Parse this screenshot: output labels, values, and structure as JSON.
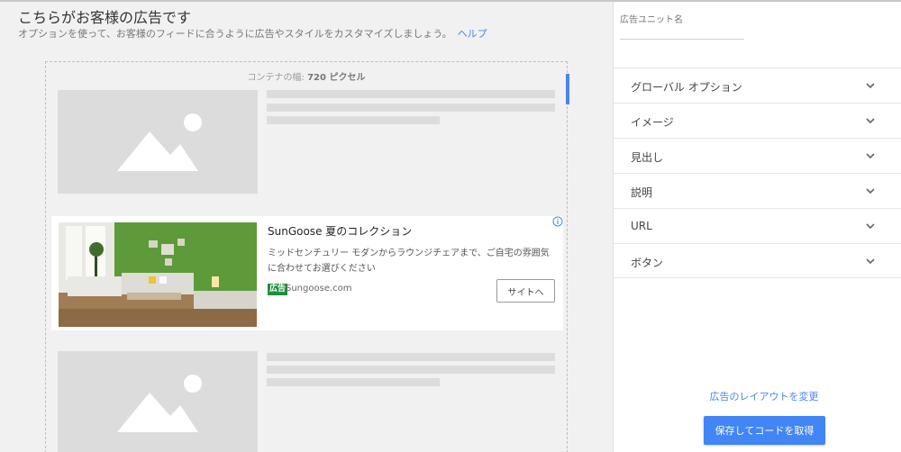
{
  "main": {
    "title": "こちらがお客様の広告です",
    "subtitle": "オプションを使って、お客様のフィードに合うように広告やスタイルをカスタマイズしましょう。",
    "help_link": "ヘルプ",
    "container_width_label": "コンテナの幅: ",
    "container_width_value": "720 ピクセル"
  },
  "ad": {
    "headline": "SunGoose 夏のコレクション",
    "description": "ミッドセンチュリー モダンからラウンジチェアまで、ご自宅の雰囲気に合わせてお選びください",
    "badge": "広告",
    "domain": "Sungoose.com",
    "cta": "サイトへ"
  },
  "panel": {
    "unit_name_label": "広告ユニット名",
    "unit_name_value": "",
    "sections": [
      {
        "label": "グローバル オプション"
      },
      {
        "label": "イメージ"
      },
      {
        "label": "見出し"
      },
      {
        "label": "説明"
      },
      {
        "label": "URL"
      },
      {
        "label": "ボタン"
      }
    ],
    "layout_link": "広告のレイアウトを変更",
    "save_button": "保存してコードを取得"
  },
  "colors": {
    "accent": "#4285f4",
    "link": "#4a86e8",
    "ad_badge": "#1e8e3e",
    "placeholder": "#dcdcdc"
  },
  "icons": {
    "section_toggle": "chevron-down-icon",
    "placeholder_image": "image-placeholder-icon",
    "ad_info": "info-icon"
  }
}
